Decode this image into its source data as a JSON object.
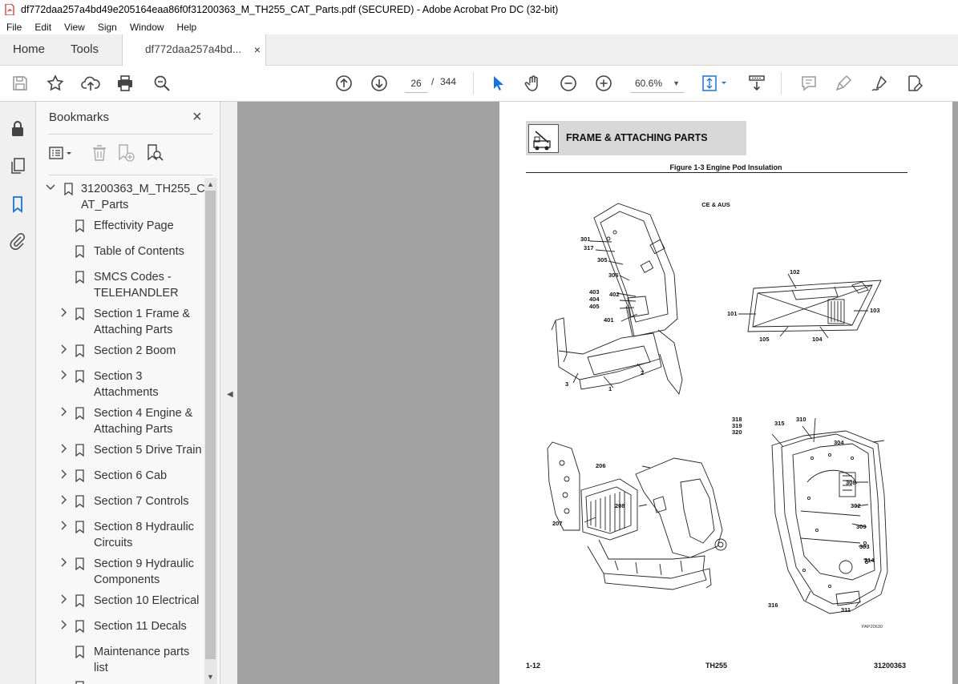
{
  "window": {
    "title": "df772daa257a4bd49e205164eaa86f0f31200363_M_TH255_CAT_Parts.pdf (SECURED) - Adobe Acrobat Pro DC (32-bit)"
  },
  "menu": [
    "File",
    "Edit",
    "View",
    "Sign",
    "Window",
    "Help"
  ],
  "tabs": {
    "home": "Home",
    "tools": "Tools",
    "document": "df772daa257a4bd...",
    "close_glyph": "×"
  },
  "toolbar": {
    "page_current": "26",
    "page_sep": "/",
    "page_total": "344",
    "zoom": "60.6%",
    "icons": [
      "save-icon",
      "bookmark-star-icon",
      "upload-icon",
      "print-icon",
      "search-zoom-icon",
      "page-up-icon",
      "page-down-icon",
      "select-cursor-icon",
      "hand-icon",
      "zoom-out-icon",
      "zoom-in-icon",
      "fit-page-icon",
      "scroll-mode-icon",
      "comment-icon",
      "highlight-icon",
      "sign-icon",
      "edit-pdf-icon"
    ]
  },
  "left_rail": {
    "icons": [
      "lock-icon",
      "pages-icon",
      "bookmark-icon",
      "attachment-icon"
    ]
  },
  "bookmarks": {
    "title": "Bookmarks",
    "close_glyph": "×",
    "root": {
      "line1": "31200363_M_TH255_C",
      "line2": "AT_Parts"
    },
    "items": [
      {
        "line1": "Effectivity Page",
        "line2": "",
        "expandable": false
      },
      {
        "line1": "Table of Contents",
        "line2": "",
        "expandable": false
      },
      {
        "line1": "SMCS Codes -",
        "line2": "TELEHANDLER",
        "expandable": false
      },
      {
        "line1": "Section 1 Frame &",
        "line2": "Attaching Parts",
        "expandable": true
      },
      {
        "line1": "Section 2 Boom",
        "line2": "",
        "expandable": true
      },
      {
        "line1": "Section 3",
        "line2": "Attachments",
        "expandable": true
      },
      {
        "line1": "Section 4 Engine &",
        "line2": "Attaching Parts",
        "expandable": true
      },
      {
        "line1": "Section 5 Drive Train",
        "line2": "",
        "expandable": true
      },
      {
        "line1": "Section 6 Cab",
        "line2": "",
        "expandable": true
      },
      {
        "line1": "Section 7 Controls",
        "line2": "",
        "expandable": true
      },
      {
        "line1": "Section 8 Hydraulic",
        "line2": "Circuits",
        "expandable": true
      },
      {
        "line1": "Section 9 Hydraulic",
        "line2": "Components",
        "expandable": true
      },
      {
        "line1": "Section 10 Electrical",
        "line2": "",
        "expandable": true
      },
      {
        "line1": "Section 11 Decals",
        "line2": "",
        "expandable": true
      },
      {
        "line1": "Maintenance parts",
        "line2": "list",
        "expandable": false
      }
    ]
  },
  "document": {
    "header_title": "FRAME & ATTACHING PARTS",
    "figure_title": "Figure 1-3 Engine Pod Insulation",
    "note": "CE & AUS",
    "callouts": [
      "301",
      "317",
      "305",
      "306",
      "403",
      "404",
      "405",
      "402",
      "401",
      "3",
      "1",
      "2",
      "102",
      "101",
      "103",
      "105",
      "104",
      "318",
      "319",
      "320",
      "315",
      "310",
      "304",
      "308",
      "302",
      "309",
      "303",
      "314",
      "316",
      "311",
      "206",
      "208",
      "207"
    ],
    "image_code": "PAP20630",
    "footer_left": "1-12",
    "footer_center": "TH255",
    "footer_right": "31200363"
  }
}
